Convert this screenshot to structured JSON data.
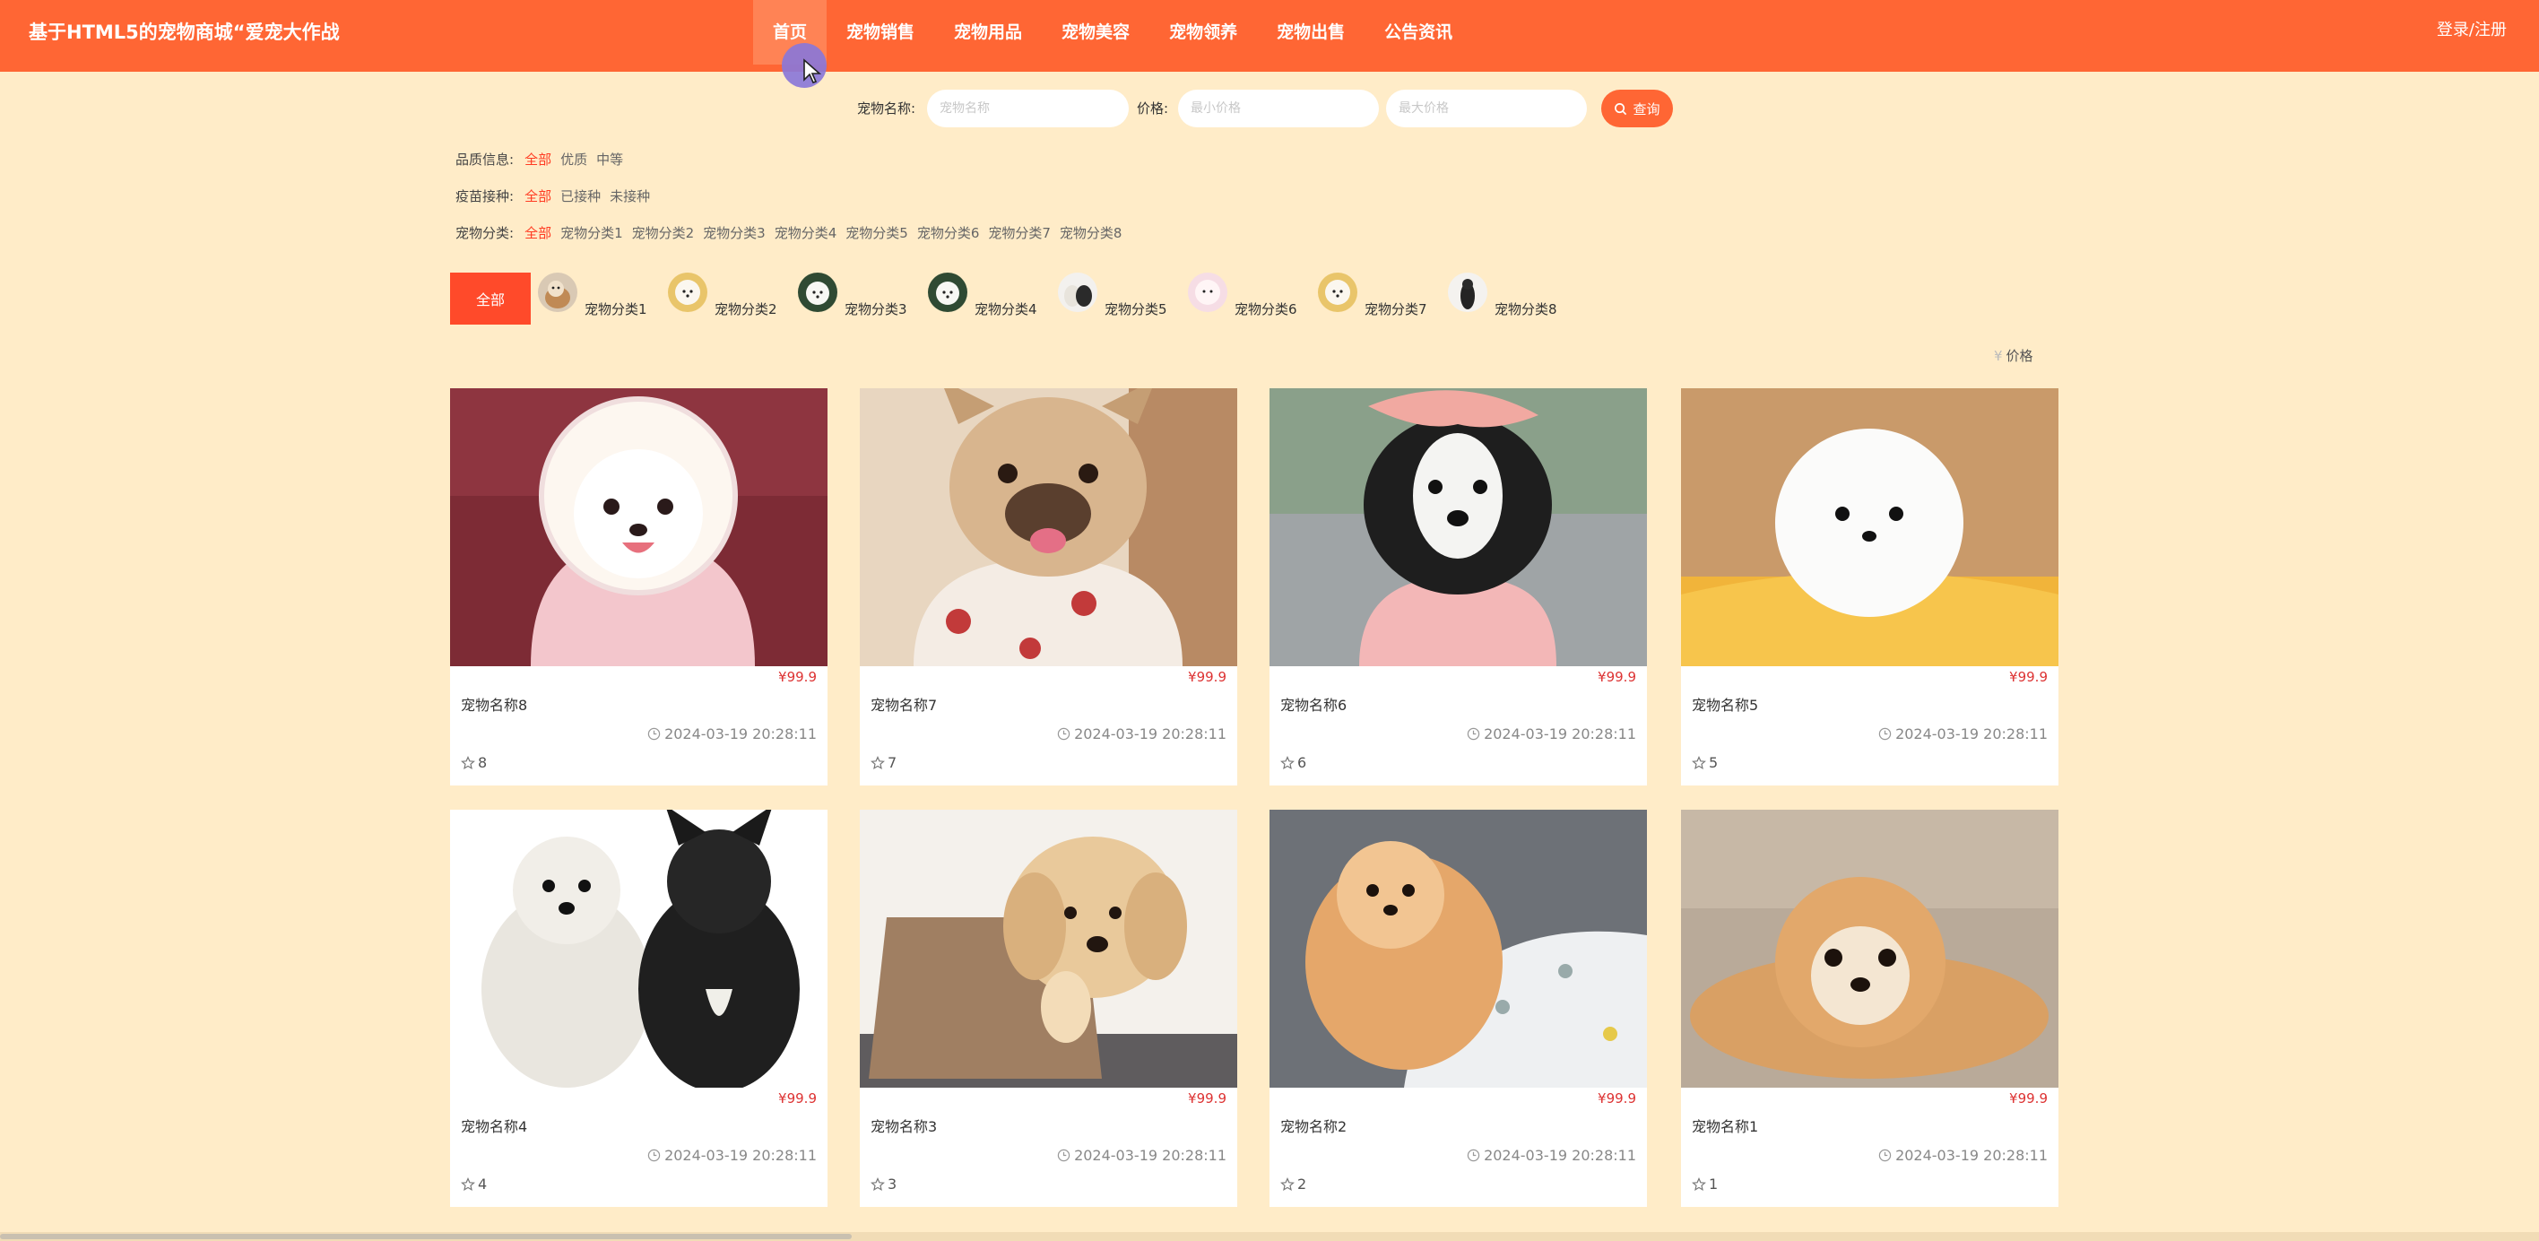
{
  "header": {
    "site_title": "基于HTML5的宠物商城“爱宠大作战",
    "nav": [
      {
        "label": "首页",
        "active": true
      },
      {
        "label": "宠物销售",
        "active": false
      },
      {
        "label": "宠物用品",
        "active": false
      },
      {
        "label": "宠物美容",
        "active": false
      },
      {
        "label": "宠物领养",
        "active": false
      },
      {
        "label": "宠物出售",
        "active": false
      },
      {
        "label": "公告资讯",
        "active": false
      }
    ],
    "login_label": "登录/注册"
  },
  "search": {
    "name_label": "宠物名称:",
    "name_placeholder": "宠物名称",
    "price_label": "价格:",
    "min_placeholder": "最小价格",
    "max_placeholder": "最大价格",
    "query_label": "查询"
  },
  "filters": {
    "quality": {
      "label": "品质信息:",
      "options": [
        "全部",
        "优质",
        "中等"
      ],
      "active": 0
    },
    "vaccine": {
      "label": "疫苗接种:",
      "options": [
        "全部",
        "已接种",
        "未接种"
      ],
      "active": 0
    },
    "category": {
      "label": "宠物分类:",
      "options": [
        "全部",
        "宠物分类1",
        "宠物分类2",
        "宠物分类3",
        "宠物分类4",
        "宠物分类5",
        "宠物分类6",
        "宠物分类7",
        "宠物分类8"
      ],
      "active": 0
    }
  },
  "category_strip": {
    "all_label": "全部",
    "items": [
      "宠物分类1",
      "宠物分类2",
      "宠物分类3",
      "宠物分类4",
      "宠物分类5",
      "宠物分类6",
      "宠物分类7",
      "宠物分类8"
    ]
  },
  "sort": {
    "yen": "¥",
    "label": "价格"
  },
  "products": [
    {
      "name": "宠物名称8",
      "price": "¥99.9",
      "time": "2024-03-19 20:28:11",
      "likes": "8"
    },
    {
      "name": "宠物名称7",
      "price": "¥99.9",
      "time": "2024-03-19 20:28:11",
      "likes": "7"
    },
    {
      "name": "宠物名称6",
      "price": "¥99.9",
      "time": "2024-03-19 20:28:11",
      "likes": "6"
    },
    {
      "name": "宠物名称5",
      "price": "¥99.9",
      "time": "2024-03-19 20:28:11",
      "likes": "5"
    },
    {
      "name": "宠物名称4",
      "price": "¥99.9",
      "time": "2024-03-19 20:28:11",
      "likes": "4"
    },
    {
      "name": "宠物名称3",
      "price": "¥99.9",
      "time": "2024-03-19 20:28:11",
      "likes": "3"
    },
    {
      "name": "宠物名称2",
      "price": "¥99.9",
      "time": "2024-03-19 20:28:11",
      "likes": "2"
    },
    {
      "name": "宠物名称1",
      "price": "¥99.9",
      "time": "2024-03-19 20:28:11",
      "likes": "1"
    }
  ],
  "colors": {
    "brand": "#ff6634",
    "accent": "#ff3b22",
    "background": "#ffecc8"
  }
}
